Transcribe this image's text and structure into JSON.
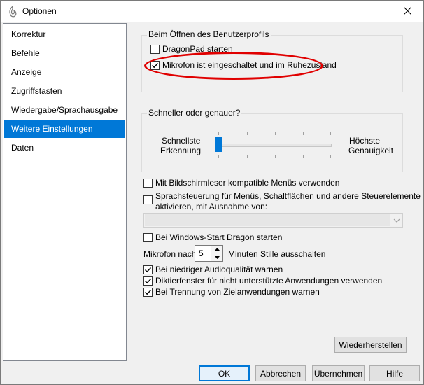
{
  "window": {
    "title": "Optionen",
    "close_glyph": "✕"
  },
  "sidebar": {
    "items": [
      {
        "label": "Korrektur",
        "selected": false
      },
      {
        "label": "Befehle",
        "selected": false
      },
      {
        "label": "Anzeige",
        "selected": false
      },
      {
        "label": "Zugriffstasten",
        "selected": false
      },
      {
        "label": "Wiedergabe/Sprachausgabe",
        "selected": false
      },
      {
        "label": "Weitere Einstellungen",
        "selected": true
      },
      {
        "label": "Daten",
        "selected": false
      }
    ]
  },
  "profile_group": {
    "title": "Beim Öffnen des Benutzerprofils",
    "dragonpad_label": "DragonPad starten",
    "dragonpad_checked": false,
    "microphone_label": "Mikrofon ist eingeschaltet und im Ruhezustand",
    "microphone_checked": true
  },
  "speed_group": {
    "title": "Schneller oder genauer?",
    "left_label_line1": "Schnellste",
    "left_label_line2": "Erkennung",
    "right_label_line1": "Höchste",
    "right_label_line2": "Genauigkeit",
    "slider_level": 0
  },
  "options": {
    "screenreader_label": "Mit Bildschirmleser kompatible Menüs verwenden",
    "screenreader_checked": false,
    "voice_control_label_line1": "Sprachsteuerung für Menüs, Schaltflächen und andere Steuerelemente",
    "voice_control_label_line2": "aktivieren, mit Ausnahme von:",
    "voice_control_checked": false,
    "exception_dropdown_value": "",
    "windows_start_label": "Bei Windows-Start Dragon starten",
    "windows_start_checked": false,
    "mic_off_prefix": "Mikrofon nach",
    "mic_off_minutes": "5",
    "mic_off_suffix": "Minuten Stille ausschalten",
    "low_audio_label": "Bei niedriger Audioqualität warnen",
    "low_audio_checked": true,
    "dictation_box_label": "Diktierfenster für nicht unterstützte Anwendungen verwenden",
    "dictation_box_checked": true,
    "target_sep_label": "Bei Trennung von Zielanwendungen warnen",
    "target_sep_checked": true
  },
  "buttons": {
    "restore": "Wiederherstellen",
    "ok": "OK",
    "cancel": "Abbrechen",
    "apply": "Übernehmen",
    "help": "Hilfe"
  },
  "colors": {
    "selection": "#0078d7",
    "highlight_annotation": "#e00000"
  }
}
